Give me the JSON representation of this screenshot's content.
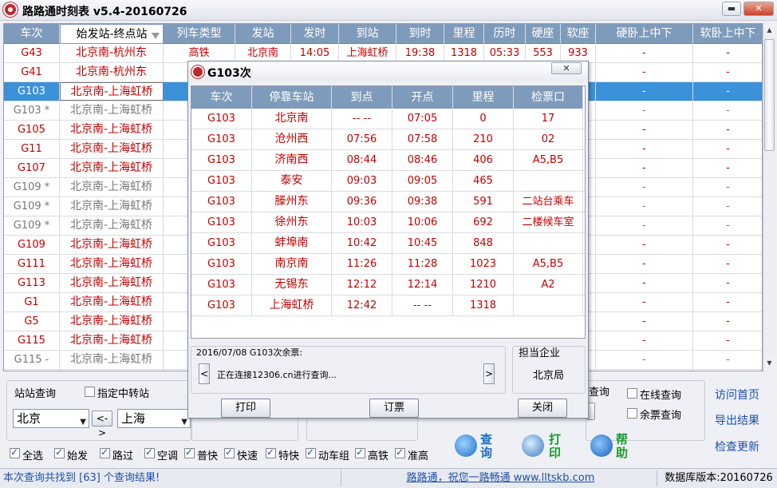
{
  "window": {
    "title": "路路通时刻表 v5.4-20160726",
    "min_label": "▬",
    "close_label": "✕"
  },
  "grid": {
    "columns": [
      "车次",
      "始发站-终点站",
      "列车类型",
      "发站",
      "发时",
      "到站",
      "到时",
      "里程",
      "历时",
      "硬座",
      "软座",
      "硬卧上中下",
      "软卧上中下"
    ],
    "rows": [
      {
        "train": "G43",
        "route": "北京南-杭州东",
        "type": "高铁",
        "from": "北京南",
        "dep": "14:05",
        "to": "上海虹桥",
        "arr": "19:38",
        "dist": "1318",
        "dur": "05:33",
        "hard": "553",
        "soft": "933",
        "hsleep": "-",
        "ssleep": "-",
        "style": "red"
      },
      {
        "train": "G41",
        "route": "北京南-杭州东",
        "type": "",
        "from": "",
        "dep": "",
        "to": "",
        "arr": "",
        "dist": "",
        "dur": "",
        "hard": "",
        "soft": "",
        "hsleep": "-",
        "ssleep": "-",
        "style": "red"
      },
      {
        "train": "G103",
        "route": "北京南-上海虹桥",
        "type": "",
        "from": "",
        "dep": "",
        "to": "",
        "arr": "",
        "dist": "",
        "dur": "",
        "hard": "",
        "soft": "",
        "hsleep": "-",
        "ssleep": "-",
        "style": "hl"
      },
      {
        "train": "G103 *",
        "route": "北京南-上海虹桥",
        "type": "",
        "from": "",
        "dep": "",
        "to": "",
        "arr": "",
        "dist": "",
        "dur": "",
        "hard": "",
        "soft": "",
        "hsleep": "-",
        "ssleep": "-",
        "style": "gray"
      },
      {
        "train": "G105",
        "route": "北京南-上海虹桥",
        "type": "",
        "from": "",
        "dep": "",
        "to": "",
        "arr": "",
        "dist": "",
        "dur": "",
        "hard": "",
        "soft": "",
        "hsleep": "-",
        "ssleep": "-",
        "style": "red"
      },
      {
        "train": "G11",
        "route": "北京南-上海虹桥",
        "type": "",
        "from": "",
        "dep": "",
        "to": "",
        "arr": "",
        "dist": "",
        "dur": "",
        "hard": "",
        "soft": "",
        "hsleep": "-",
        "ssleep": "-",
        "style": "red"
      },
      {
        "train": "G107",
        "route": "北京南-上海虹桥",
        "type": "",
        "from": "",
        "dep": "",
        "to": "",
        "arr": "",
        "dist": "",
        "dur": "",
        "hard": "",
        "soft": "",
        "hsleep": "-",
        "ssleep": "-",
        "style": "red"
      },
      {
        "train": "G109 *",
        "route": "北京南-上海虹桥",
        "type": "",
        "from": "",
        "dep": "",
        "to": "",
        "arr": "",
        "dist": "",
        "dur": "",
        "hard": "",
        "soft": "",
        "hsleep": "-",
        "ssleep": "-",
        "style": "gray"
      },
      {
        "train": "G109 *",
        "route": "北京南-上海虹桥",
        "type": "",
        "from": "",
        "dep": "",
        "to": "",
        "arr": "",
        "dist": "",
        "dur": "",
        "hard": "",
        "soft": "",
        "hsleep": "-",
        "ssleep": "-",
        "style": "gray"
      },
      {
        "train": "G109 *",
        "route": "北京南-上海虹桥",
        "type": "",
        "from": "",
        "dep": "",
        "to": "",
        "arr": "",
        "dist": "",
        "dur": "",
        "hard": "",
        "soft": "",
        "hsleep": "-",
        "ssleep": "-",
        "style": "gray"
      },
      {
        "train": "G109",
        "route": "北京南-上海虹桥",
        "type": "",
        "from": "",
        "dep": "",
        "to": "",
        "arr": "",
        "dist": "",
        "dur": "",
        "hard": "",
        "soft": "",
        "hsleep": "-",
        "ssleep": "-",
        "style": "red"
      },
      {
        "train": "G111",
        "route": "北京南-上海虹桥",
        "type": "",
        "from": "",
        "dep": "",
        "to": "",
        "arr": "",
        "dist": "",
        "dur": "",
        "hard": "",
        "soft": "",
        "hsleep": "-",
        "ssleep": "-",
        "style": "red"
      },
      {
        "train": "G113",
        "route": "北京南-上海虹桥",
        "type": "",
        "from": "",
        "dep": "",
        "to": "",
        "arr": "",
        "dist": "",
        "dur": "",
        "hard": "",
        "soft": "",
        "hsleep": "-",
        "ssleep": "-",
        "style": "red"
      },
      {
        "train": "G1",
        "route": "北京南-上海虹桥",
        "type": "",
        "from": "",
        "dep": "",
        "to": "",
        "arr": "",
        "dist": "",
        "dur": "",
        "hard": "",
        "soft": "",
        "hsleep": "-",
        "ssleep": "-",
        "style": "red"
      },
      {
        "train": "G5",
        "route": "北京南-上海虹桥",
        "type": "",
        "from": "",
        "dep": "",
        "to": "",
        "arr": "",
        "dist": "",
        "dur": "",
        "hard": "",
        "soft": "",
        "hsleep": "-",
        "ssleep": "-",
        "style": "red"
      },
      {
        "train": "G115",
        "route": "北京南-上海虹桥",
        "type": "",
        "from": "",
        "dep": "",
        "to": "",
        "arr": "",
        "dist": "",
        "dur": "",
        "hard": "",
        "soft": "",
        "hsleep": "-",
        "ssleep": "-",
        "style": "red"
      },
      {
        "train": "G115 -",
        "route": "北京南-上海虹桥",
        "type": "",
        "from": "",
        "dep": "",
        "to": "",
        "arr": "",
        "dist": "",
        "dur": "",
        "hard": "",
        "soft": "",
        "hsleep": "-",
        "ssleep": "-",
        "style": "gray"
      },
      {
        "train": "",
        "route": "",
        "type": "",
        "from": "",
        "dep": "",
        "to": "",
        "arr": "",
        "dist": "",
        "dur": "",
        "hard": "",
        "soft": "",
        "hsleep": "",
        "ssleep": "",
        "style": "gray"
      }
    ]
  },
  "query": {
    "station_label": "站站查询",
    "transfer_label": "指定中转站",
    "from_station": "北京",
    "to_station": "上海",
    "swap_label": "<->",
    "query_fragment": "查询",
    "online_label": "在线查询",
    "remain_label": "余票查询",
    "filters": [
      {
        "label": "全选",
        "on": true
      },
      {
        "label": "始发",
        "on": true
      },
      {
        "label": "路过",
        "on": true
      },
      {
        "label": "空调",
        "on": true
      },
      {
        "label": "普快",
        "on": true
      },
      {
        "label": "快速",
        "on": true
      },
      {
        "label": "特快",
        "on": true
      },
      {
        "label": "动车组",
        "on": true
      },
      {
        "label": "高铁",
        "on": true
      },
      {
        "label": "准高",
        "on": true
      }
    ],
    "btn_query": "查询",
    "btn_print": "打印",
    "btn_help": "帮助"
  },
  "links": {
    "home": "访问首页",
    "export": "导出结果",
    "update": "检查更新"
  },
  "status": {
    "result": "本次查询共找到 [63] 个查询结果!",
    "slogan": "路路通，祝您一路畅通 www.lltskb.com",
    "db_version": "数据库版本:20160726"
  },
  "dialog": {
    "title": "G103次",
    "close_label": "✕",
    "columns": [
      "车次",
      "停靠车站",
      "到点",
      "开点",
      "里程",
      "检票口"
    ],
    "stops": [
      {
        "train": "G103",
        "station": "北京南",
        "arr": "-- --",
        "dep": "07:05",
        "dist": "0",
        "gate": "17"
      },
      {
        "train": "G103",
        "station": "沧州西",
        "arr": "07:56",
        "dep": "07:58",
        "dist": "210",
        "gate": "02"
      },
      {
        "train": "G103",
        "station": "济南西",
        "arr": "08:44",
        "dep": "08:46",
        "dist": "406",
        "gate": "A5,B5"
      },
      {
        "train": "G103",
        "station": "泰安",
        "arr": "09:03",
        "dep": "09:05",
        "dist": "465",
        "gate": ""
      },
      {
        "train": "G103",
        "station": "滕州东",
        "arr": "09:36",
        "dep": "09:38",
        "dist": "591",
        "gate": "二站台乘车"
      },
      {
        "train": "G103",
        "station": "徐州东",
        "arr": "10:03",
        "dep": "10:06",
        "dist": "692",
        "gate": "二楼候车室"
      },
      {
        "train": "G103",
        "station": "蚌埠南",
        "arr": "10:42",
        "dep": "10:45",
        "dist": "848",
        "gate": ""
      },
      {
        "train": "G103",
        "station": "南京南",
        "arr": "11:26",
        "dep": "11:28",
        "dist": "1023",
        "gate": "A5,B5"
      },
      {
        "train": "G103",
        "station": "无锡东",
        "arr": "12:12",
        "dep": "12:14",
        "dist": "1210",
        "gate": "A2"
      },
      {
        "train": "G103",
        "station": "上海虹桥",
        "arr": "12:42",
        "dep": "-- --",
        "dist": "1318",
        "gate": ""
      }
    ],
    "remain_label": "2016/07/08 G103次余票:",
    "remain_status": "正在连接12306.cn进行查询...",
    "company_label": "担当企业",
    "company": "北京局",
    "btn_print": "打印",
    "btn_order": "订票",
    "btn_close": "关闭",
    "prev_label": "<",
    "next_label": ">"
  },
  "colors": {
    "header": "#7f9bbb",
    "highlight": "#3b92d8",
    "train_red": "#c40000",
    "link": "#1f4fa8"
  }
}
